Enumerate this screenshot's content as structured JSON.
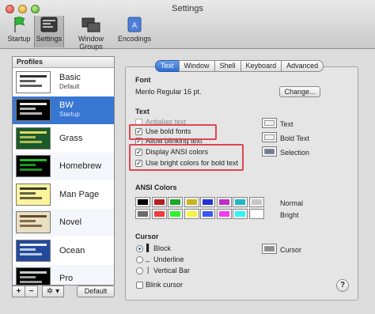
{
  "window": {
    "title": "Settings"
  },
  "toolbar": [
    {
      "label": "Startup",
      "icon": "flag-icon"
    },
    {
      "label": "Settings",
      "icon": "settings-icon"
    },
    {
      "label": "Window Groups",
      "icon": "window-groups-icon"
    },
    {
      "label": "Encodings",
      "icon": "encodings-icon"
    }
  ],
  "profiles": {
    "header": "Profiles",
    "items": [
      {
        "name": "Basic",
        "sub": "Default",
        "bg": "#ffffff",
        "fg": "#1a1a1a"
      },
      {
        "name": "BW",
        "sub": "Startup",
        "bg": "#000000",
        "fg": "#ffffff"
      },
      {
        "name": "Grass",
        "sub": "",
        "bg": "#1a5a2a",
        "fg": "#f5e36b"
      },
      {
        "name": "Homebrew",
        "sub": "",
        "bg": "#000000",
        "fg": "#29d12d"
      },
      {
        "name": "Man Page",
        "sub": "",
        "bg": "#fef49c",
        "fg": "#222222"
      },
      {
        "name": "Novel",
        "sub": "",
        "bg": "#e9dfc3",
        "fg": "#5a3a1a"
      },
      {
        "name": "Ocean",
        "sub": "",
        "bg": "#234a9a",
        "fg": "#ffffff"
      },
      {
        "name": "Pro",
        "sub": "",
        "bg": "#000000",
        "fg": "#e0e0e0"
      }
    ],
    "add_label": "+",
    "remove_label": "−",
    "action_label": "✲ ▾",
    "default_label": "Default"
  },
  "tabs": [
    "Text",
    "Window",
    "Shell",
    "Keyboard",
    "Advanced"
  ],
  "font": {
    "section": "Font",
    "value": "Menlo Regular 16 pt.",
    "change_label": "Change..."
  },
  "text": {
    "section": "Text",
    "antialias": "Antialias text",
    "bold_fonts": "Use bold fonts",
    "blinking": "Allow blinking text",
    "ansi_colors": "Display ANSI colors",
    "bright_bold": "Use bright colors for bold text",
    "wells": [
      {
        "label": "Text",
        "color": "#f2f2f2"
      },
      {
        "label": "Bold Text",
        "color": "#f2f2f2"
      },
      {
        "label": "Selection",
        "color": "#6b7d9e"
      }
    ]
  },
  "ansi": {
    "section": "ANSI Colors",
    "normal_label": "Normal",
    "bright_label": "Bright",
    "normal": [
      "#000000",
      "#b81e1e",
      "#1fa82a",
      "#c8b51e",
      "#2630d8",
      "#c02ec4",
      "#1fb7c4",
      "#c7c7c7"
    ],
    "bright": [
      "#6b6b6b",
      "#f23a3a",
      "#2ef52e",
      "#f5f53a",
      "#3a58f5",
      "#f23af2",
      "#2ef5f5",
      "#ffffff"
    ]
  },
  "cursor": {
    "section": "Cursor",
    "block": "Block",
    "underline": "Underline",
    "vertical": "Vertical Bar",
    "blink": "Blink cursor",
    "well_label": "Cursor",
    "well_color": "#8c8c8c"
  },
  "help_label": "?"
}
